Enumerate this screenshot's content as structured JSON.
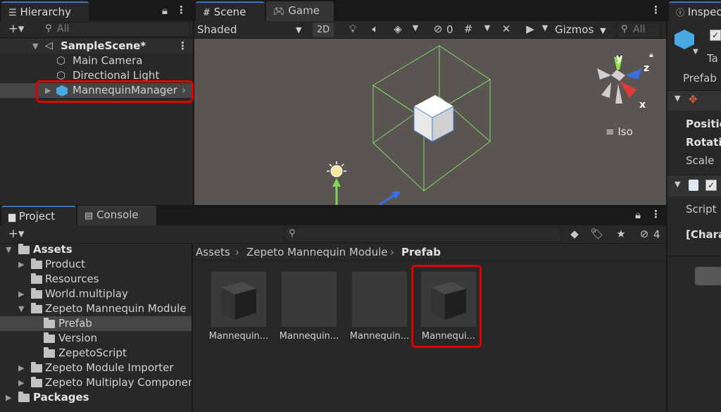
{
  "hierarchy": {
    "tab_label": "Hierarchy",
    "search_placeholder": "All",
    "scene_name": "SampleScene*",
    "items": [
      {
        "label": "Main Camera"
      },
      {
        "label": "Directional Light"
      },
      {
        "label": "MannequinManager"
      }
    ]
  },
  "scene": {
    "tab_scene": "Scene",
    "tab_game": "Game",
    "shading_mode": "Shaded",
    "mode_2d": "2D",
    "hidden_count": "0",
    "gizmos_label": "Gizmos",
    "search_placeholder": "All",
    "view_mode": "Iso",
    "axis_x": "x",
    "axis_y": "y",
    "axis_z": "z"
  },
  "project": {
    "tab_project": "Project",
    "tab_console": "Console",
    "hidden_count": "4",
    "tree": [
      {
        "label": "Assets"
      },
      {
        "label": "Product"
      },
      {
        "label": "Resources"
      },
      {
        "label": "World.multiplay"
      },
      {
        "label": "Zepeto Mannequin Module"
      },
      {
        "label": "Prefab"
      },
      {
        "label": "Version"
      },
      {
        "label": "ZepetoScript"
      },
      {
        "label": "Zepeto Module Importer"
      },
      {
        "label": "Zepeto Multiplay Componen"
      },
      {
        "label": "Packages"
      }
    ],
    "breadcrumb": [
      "Assets",
      "Zepeto Mannequin Module",
      "Prefab"
    ],
    "assets": [
      {
        "label": "Mannequin..."
      },
      {
        "label": "Mannequin..."
      },
      {
        "label": "Mannequin..."
      },
      {
        "label": "Mannequi..."
      }
    ]
  },
  "inspector": {
    "tab_label": "Inspec",
    "tag_label": "Ta",
    "prefab_label": "Prefab",
    "position_label": "Positic",
    "rotation_label": "Rotatic",
    "scale_label": "Scale",
    "script_label": "Script",
    "component_label": "[Chara"
  },
  "colors": {
    "highlight_box": "#e00000",
    "scene_bg": "#5a5550",
    "selected_row": "#464646"
  }
}
